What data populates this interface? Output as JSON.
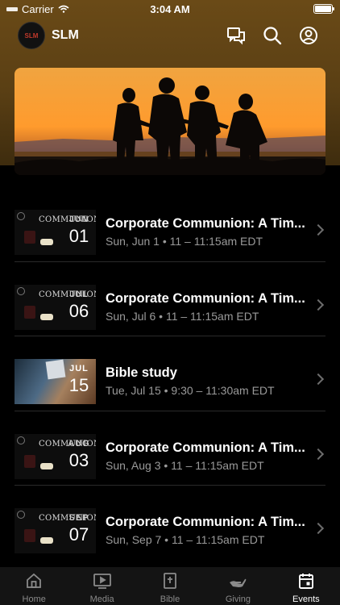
{
  "status_bar": {
    "carrier": "Carrier",
    "time": "3:04 AM"
  },
  "header": {
    "logo_text": "SLM",
    "title": "SLM"
  },
  "events": [
    {
      "title": "Corporate Communion: A Tim...",
      "subtitle": "Sun, Jun 1 • 11 – 11:15am EDT",
      "thumb_word": "COMMUNION",
      "thumb_month": "JUN",
      "thumb_day": "01",
      "thumb_type": "communion"
    },
    {
      "title": "Corporate Communion: A Tim...",
      "subtitle": "Sun, Jul 6 • 11 – 11:15am EDT",
      "thumb_word": "COMMUNION",
      "thumb_month": "JUL",
      "thumb_day": "06",
      "thumb_type": "communion"
    },
    {
      "title": "Bible study",
      "subtitle": "Tue, Jul 15 • 9:30 – 11:30am EDT",
      "thumb_word": "",
      "thumb_month": "JUL",
      "thumb_day": "15",
      "thumb_type": "bible"
    },
    {
      "title": "Corporate Communion: A Tim...",
      "subtitle": "Sun, Aug 3 • 11 – 11:15am EDT",
      "thumb_word": "COMMUNION",
      "thumb_month": "AUG",
      "thumb_day": "03",
      "thumb_type": "communion"
    },
    {
      "title": "Corporate Communion: A Tim...",
      "subtitle": "Sun, Sep 7 • 11 – 11:15am EDT",
      "thumb_word": "COMMUNION",
      "thumb_month": "SEP",
      "thumb_day": "07",
      "thumb_type": "communion"
    }
  ],
  "tabs": [
    {
      "label": "Home",
      "icon": "home-icon",
      "active": false
    },
    {
      "label": "Media",
      "icon": "media-icon",
      "active": false
    },
    {
      "label": "Bible",
      "icon": "bible-icon",
      "active": false
    },
    {
      "label": "Giving",
      "icon": "giving-icon",
      "active": false
    },
    {
      "label": "Events",
      "icon": "calendar-icon",
      "active": true
    }
  ],
  "colors": {
    "header_gradient_top": "#6a4a17",
    "accent": "#ffffff",
    "muted": "#9a9a9a"
  }
}
